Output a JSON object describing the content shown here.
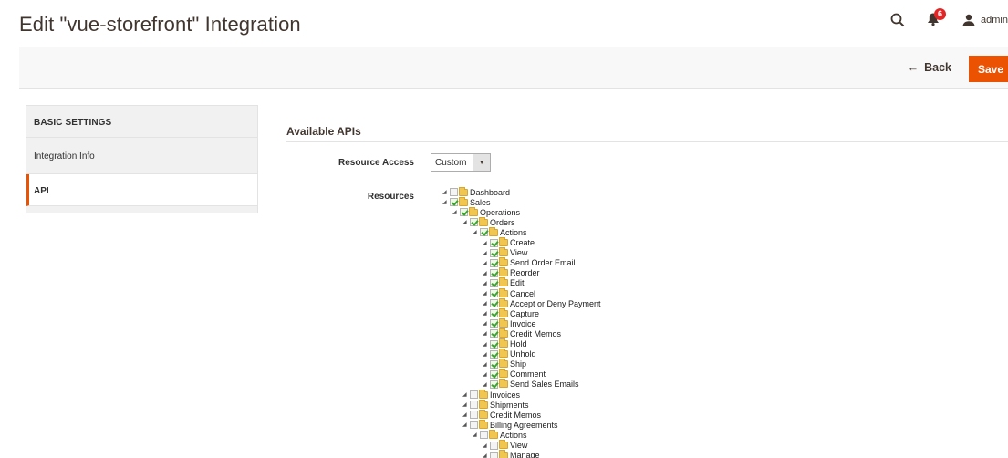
{
  "header": {
    "title": "Edit \"vue-storefront\" Integration",
    "notification_count": "6",
    "user_name": "admin"
  },
  "actions": {
    "back_label": "Back",
    "save_label": "Save"
  },
  "sidebar": {
    "heading": "BASIC SETTINGS",
    "items": [
      {
        "label": "Integration Info",
        "active": false
      },
      {
        "label": "API",
        "active": true
      }
    ]
  },
  "main": {
    "section_title": "Available APIs",
    "resource_access_label": "Resource Access",
    "resource_access_value": "Custom",
    "resources_label": "Resources",
    "tree": [
      {
        "label": "Dashboard",
        "level": 0,
        "checked": false
      },
      {
        "label": "Sales",
        "level": 0,
        "checked": true
      },
      {
        "label": "Operations",
        "level": 1,
        "checked": true
      },
      {
        "label": "Orders",
        "level": 2,
        "checked": true
      },
      {
        "label": "Actions",
        "level": 3,
        "checked": true
      },
      {
        "label": "Create",
        "level": 4,
        "checked": true
      },
      {
        "label": "View",
        "level": 4,
        "checked": true
      },
      {
        "label": "Send Order Email",
        "level": 4,
        "checked": true
      },
      {
        "label": "Reorder",
        "level": 4,
        "checked": true
      },
      {
        "label": "Edit",
        "level": 4,
        "checked": true
      },
      {
        "label": "Cancel",
        "level": 4,
        "checked": true
      },
      {
        "label": "Accept or Deny Payment",
        "level": 4,
        "checked": true
      },
      {
        "label": "Capture",
        "level": 4,
        "checked": true
      },
      {
        "label": "Invoice",
        "level": 4,
        "checked": true
      },
      {
        "label": "Credit Memos",
        "level": 4,
        "checked": true
      },
      {
        "label": "Hold",
        "level": 4,
        "checked": true
      },
      {
        "label": "Unhold",
        "level": 4,
        "checked": true
      },
      {
        "label": "Ship",
        "level": 4,
        "checked": true
      },
      {
        "label": "Comment",
        "level": 4,
        "checked": true
      },
      {
        "label": "Send Sales Emails",
        "level": 4,
        "checked": true
      },
      {
        "label": "Invoices",
        "level": 2,
        "checked": false
      },
      {
        "label": "Shipments",
        "level": 2,
        "checked": false
      },
      {
        "label": "Credit Memos",
        "level": 2,
        "checked": false
      },
      {
        "label": "Billing Agreements",
        "level": 2,
        "checked": false
      },
      {
        "label": "Actions",
        "level": 3,
        "checked": false
      },
      {
        "label": "View",
        "level": 4,
        "checked": false
      },
      {
        "label": "Manage",
        "level": 4,
        "checked": false
      }
    ]
  },
  "colors": {
    "accent": "#eb5202",
    "badge": "#e22626",
    "check": "#3aa52e",
    "folder": "#f0c550"
  },
  "icons": [
    "search-icon",
    "bell-icon",
    "user-icon",
    "back-arrow-icon",
    "chevron-down-icon",
    "expand-triangle-icon",
    "checkbox-icon",
    "folder-icon"
  ]
}
